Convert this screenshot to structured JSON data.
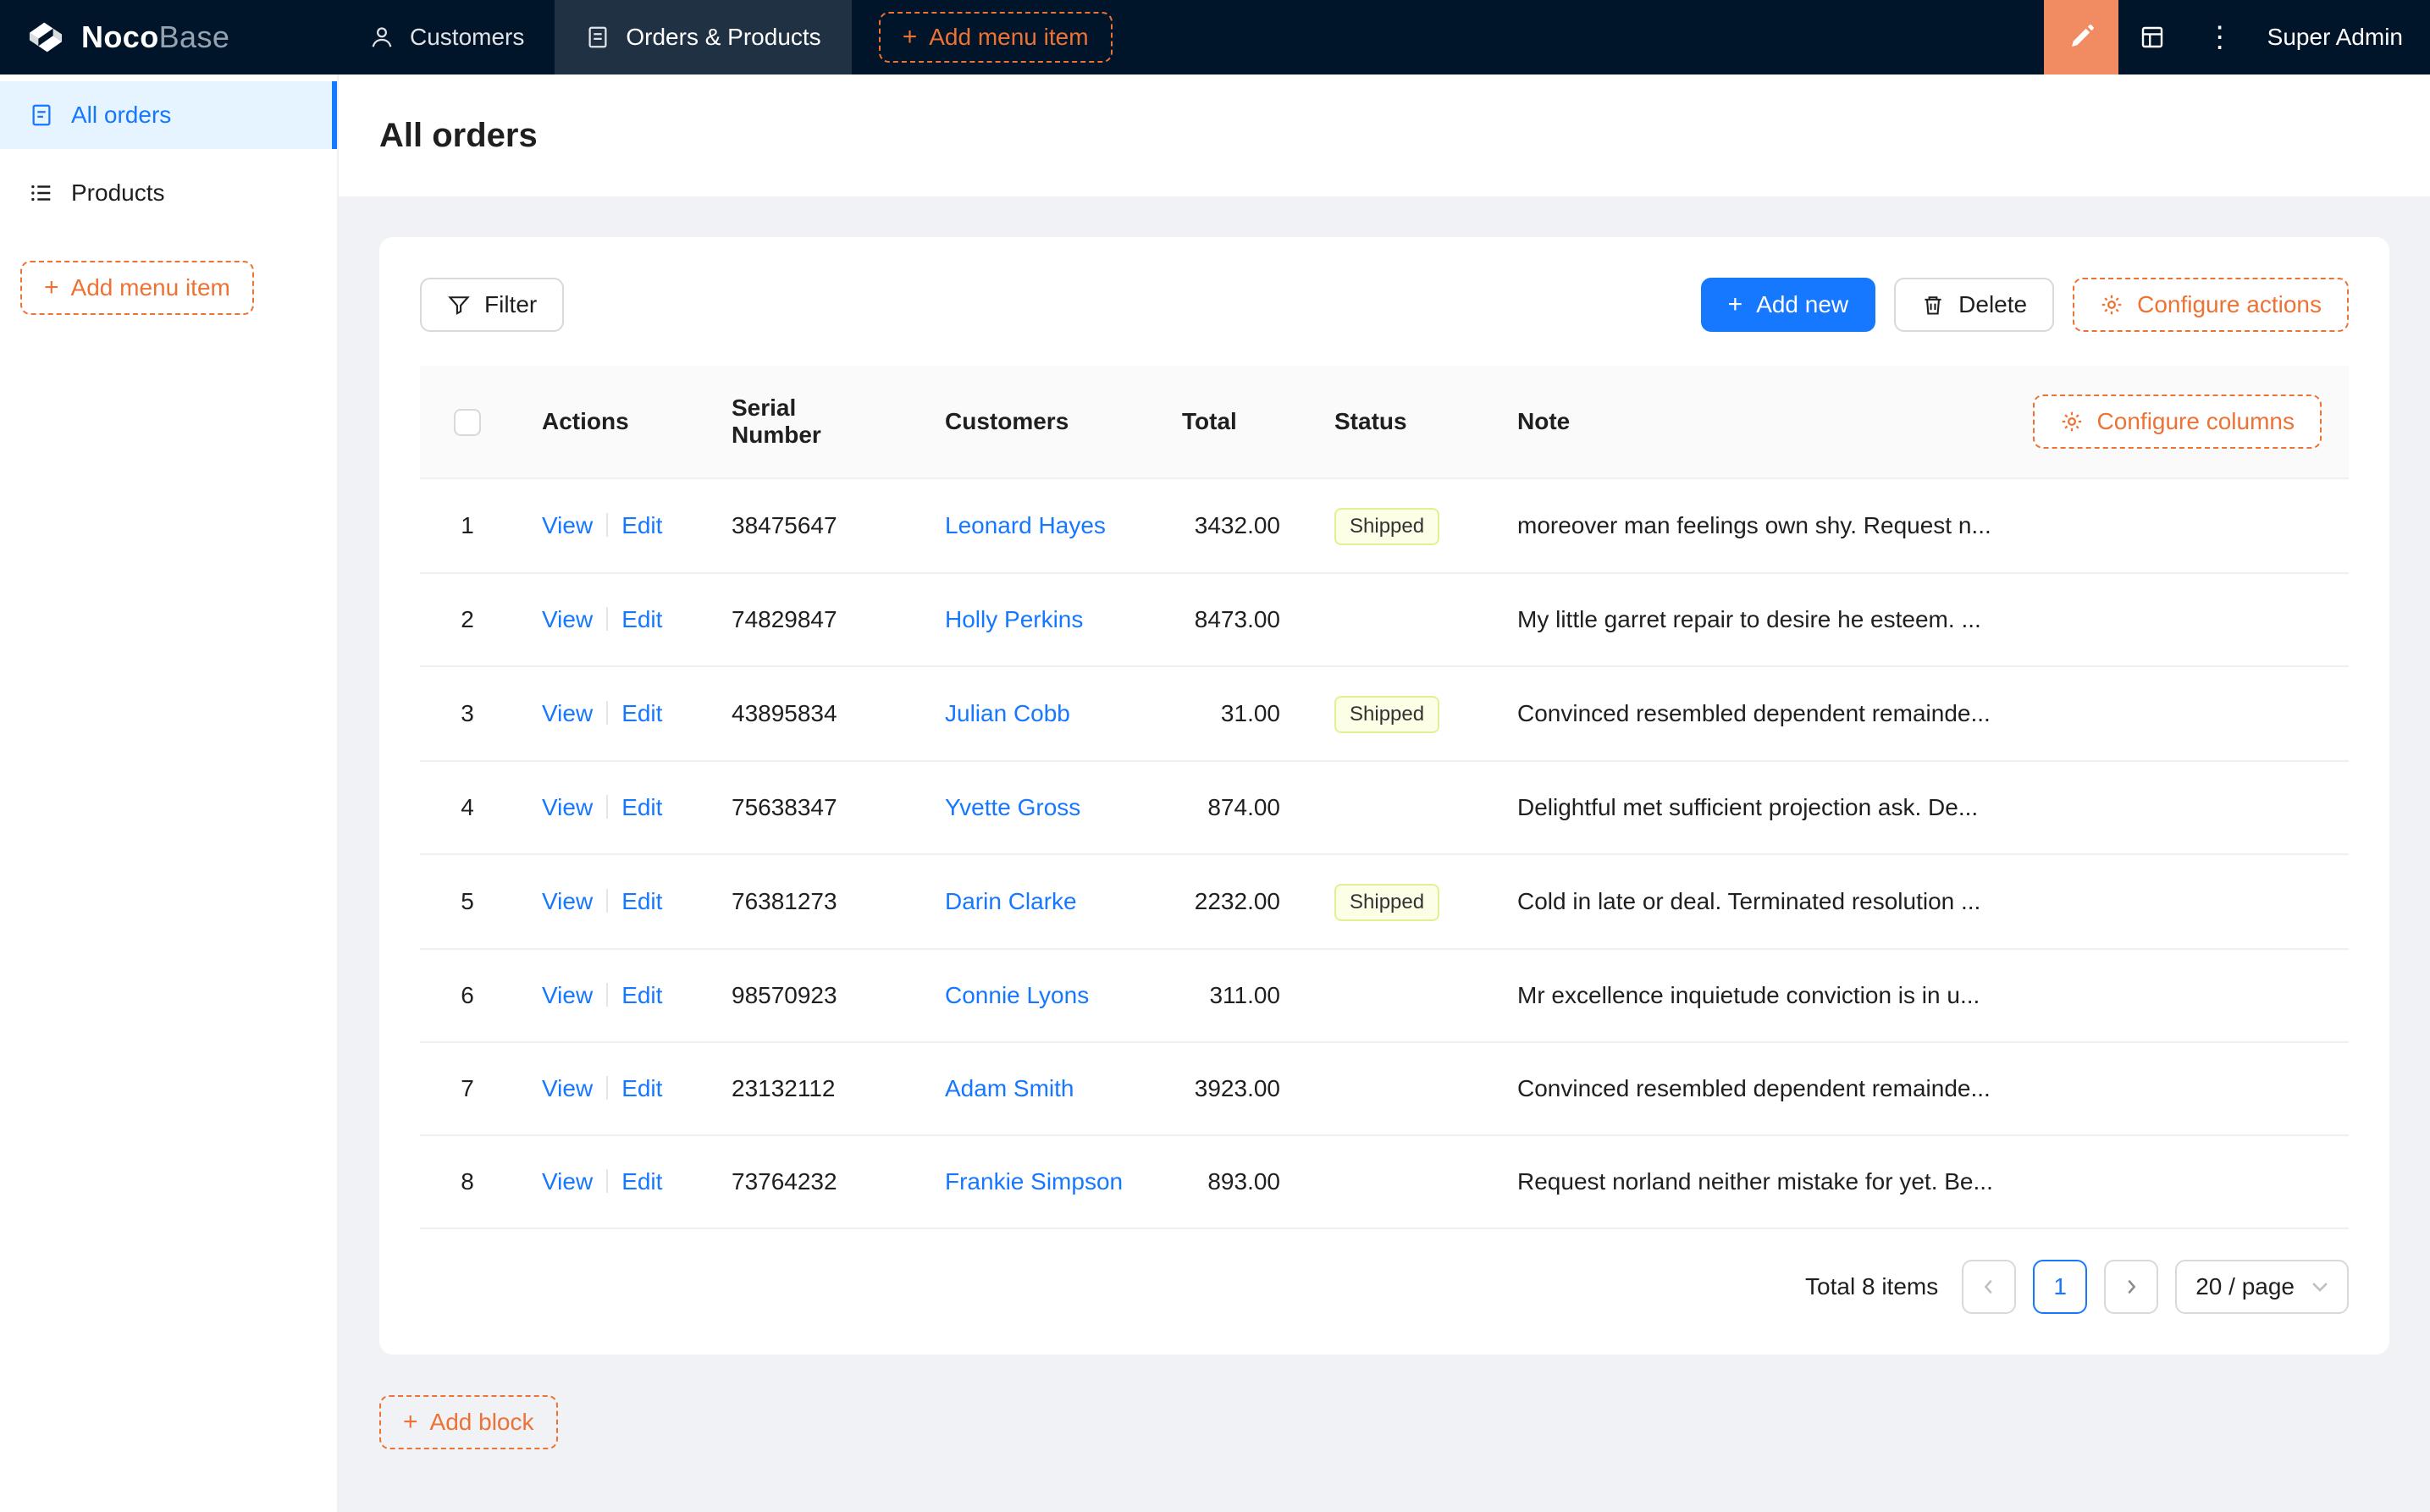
{
  "topbar": {
    "brand": {
      "noco": "Noco",
      "base": "Base"
    },
    "nav": [
      {
        "label": "Customers"
      },
      {
        "label": "Orders & Products"
      }
    ],
    "add_menu_item_label": "Add menu item",
    "user_label": "Super Admin"
  },
  "sidebar": {
    "items": [
      {
        "label": "All orders"
      },
      {
        "label": "Products"
      }
    ],
    "add_menu_item_label": "Add menu item"
  },
  "page": {
    "title": "All orders"
  },
  "toolbar": {
    "filter_label": "Filter",
    "add_new_label": "Add new",
    "delete_label": "Delete",
    "configure_actions_label": "Configure actions"
  },
  "table": {
    "headers": [
      "Actions",
      "Serial Number",
      "Customers",
      "Total",
      "Status",
      "Note"
    ],
    "configure_columns_label": "Configure columns",
    "view_label": "View",
    "edit_label": "Edit",
    "rows": [
      {
        "index": "1",
        "serial": "38475647",
        "customer": "Leonard Hayes",
        "total": "3432.00",
        "status": "Shipped",
        "note": "moreover man feelings own shy. Request n..."
      },
      {
        "index": "2",
        "serial": "74829847",
        "customer": "Holly Perkins",
        "total": "8473.00",
        "status": "",
        "note": "My little garret repair to desire he esteem. ..."
      },
      {
        "index": "3",
        "serial": "43895834",
        "customer": "Julian Cobb",
        "total": "31.00",
        "status": "Shipped",
        "note": "Convinced resembled dependent remainde..."
      },
      {
        "index": "4",
        "serial": "75638347",
        "customer": "Yvette Gross",
        "total": "874.00",
        "status": "",
        "note": "Delightful met sufficient projection ask. De..."
      },
      {
        "index": "5",
        "serial": "76381273",
        "customer": "Darin Clarke",
        "total": "2232.00",
        "status": "Shipped",
        "note": "Cold in late or deal. Terminated resolution ..."
      },
      {
        "index": "6",
        "serial": "98570923",
        "customer": "Connie Lyons",
        "total": "311.00",
        "status": "",
        "note": "Mr excellence inquietude conviction is in u..."
      },
      {
        "index": "7",
        "serial": "23132112",
        "customer": "Adam Smith",
        "total": "3923.00",
        "status": "",
        "note": "Convinced resembled dependent remainde..."
      },
      {
        "index": "8",
        "serial": "73764232",
        "customer": "Frankie Simpson",
        "total": "893.00",
        "status": "",
        "note": "Request norland neither mistake for yet. Be..."
      }
    ]
  },
  "pagination": {
    "total_label": "Total 8 items",
    "current_page": "1",
    "page_size_label": "20 / page"
  },
  "add_block_label": "Add block",
  "icons": {
    "plus": "+",
    "ellipsis": "⋮"
  },
  "colors": {
    "accent": "#1677ff",
    "settings_orange": "#ed7234",
    "designer_button_bg": "#f18b62",
    "topbar_bg": "#001529",
    "sidebar_selected_bg": "#e6f4ff",
    "content_bg": "#f0f2f5",
    "status_tag_bg": "#fcffe6",
    "status_tag_border": "#e3ef94",
    "status_tag_text": "#333333"
  }
}
